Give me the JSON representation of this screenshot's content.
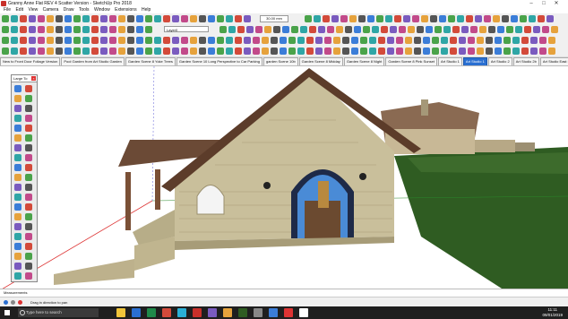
{
  "window": {
    "title": "Granny Anne Flat REV 4 Scatter Version - SketchUp Pro 2018",
    "minimize_icon": "minimize-icon",
    "maximize_icon": "maximize-icon",
    "close_icon": "close-icon"
  },
  "menu": [
    "File",
    "Edit",
    "View",
    "Camera",
    "Draw",
    "Tools",
    "Window",
    "Extensions",
    "Help"
  ],
  "toolbar": {
    "layer_select": "Layer0",
    "scale_readout": "30.00 mm"
  },
  "scene_tabs": [
    "New to Front Door Foliage Version",
    "Pool Garden from Art Studio Garden",
    "Garden Scene 8 Yoke Trees",
    "Garden Scene 10 Long Perspective to Car Parking",
    "garden Scene 10b",
    "Garden Scene 8 Midday",
    "Garden Scene 8 Night",
    "Garden Scene 8 Pink Sunset",
    "Art Studio 1",
    "Art Studio 1",
    "Art Studio 2",
    "Art Studio 2b",
    "Art Studio East Loggia",
    "Art Studio 3",
    "Art Studio 4",
    "Art Studio 5"
  ],
  "active_tab_index": 9,
  "palette": {
    "title": "Large To",
    "close_icon": "close-icon"
  },
  "measurements_label": "Measurements",
  "status_hint": "Drag in direction to pan",
  "taskbar": {
    "search_placeholder": "Type here to search",
    "time": "11:11",
    "date": "09/01/2019"
  },
  "colors": {
    "sky": "#ffffff",
    "grass": "#2f5c22",
    "stone": "#c9bf9b",
    "roof": "#6b4a36",
    "window_blue": "#4a8bd6",
    "accent_tab": "#2a6fd1"
  }
}
